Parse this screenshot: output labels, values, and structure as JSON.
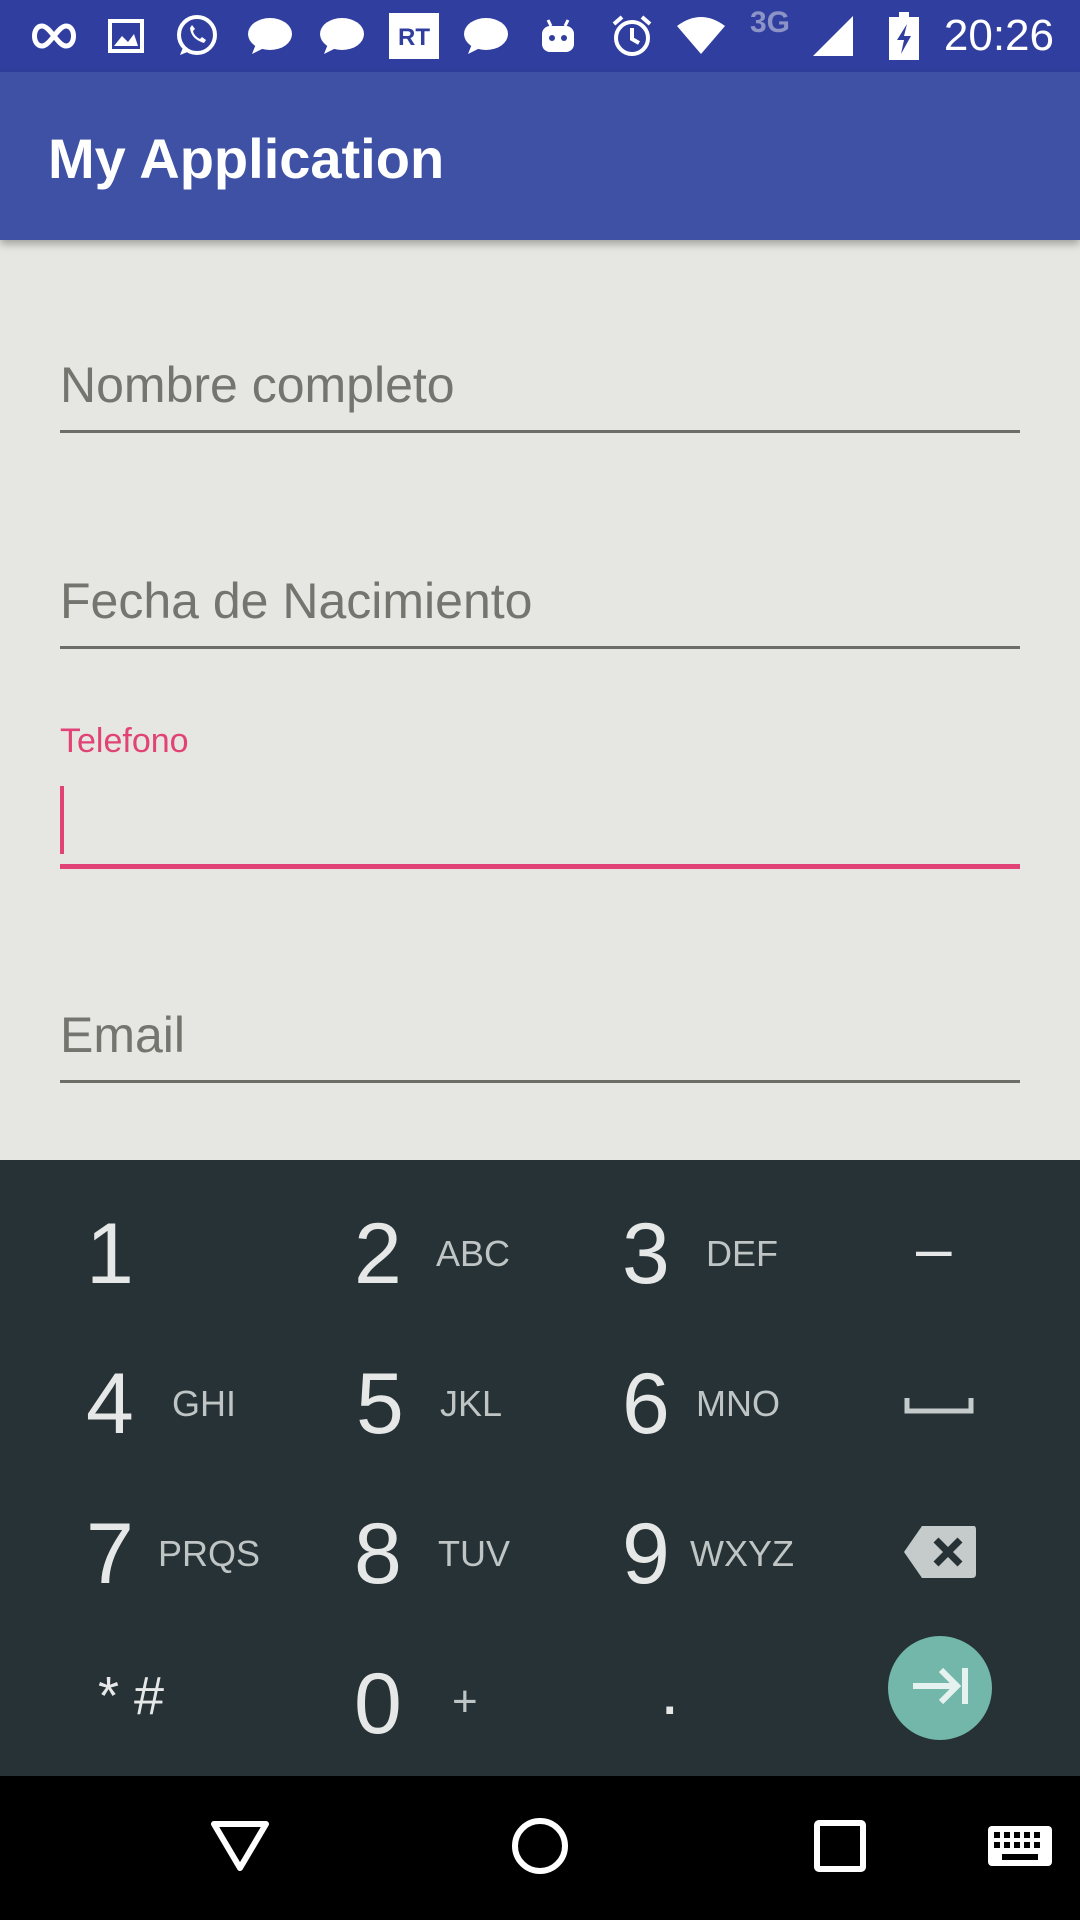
{
  "status_bar": {
    "time": "20:26",
    "network": "3G",
    "icons": [
      "infinity-icon",
      "image-icon",
      "whatsapp-icon",
      "chat-bubble-icon",
      "chat-bubble-icon",
      "rt-news-icon",
      "chat-bubble-icon",
      "android-icon",
      "alarm-icon",
      "wifi-icon",
      "signal-icon",
      "battery-charging-icon"
    ]
  },
  "app_bar": {
    "title": "My Application"
  },
  "form": {
    "nombre_placeholder": "Nombre completo",
    "fecha_placeholder": "Fecha de Nacimiento",
    "telefono_label": "Telefono",
    "telefono_value": "",
    "email_placeholder": "Email"
  },
  "keypad": {
    "keys": [
      {
        "digit": "1",
        "letters": ""
      },
      {
        "digit": "2",
        "letters": "ABC"
      },
      {
        "digit": "3",
        "letters": "DEF"
      },
      {
        "digit": "–",
        "letters": ""
      },
      {
        "digit": "4",
        "letters": "GHI"
      },
      {
        "digit": "5",
        "letters": "JKL"
      },
      {
        "digit": "6",
        "letters": "MNO"
      },
      {
        "digit": "7",
        "letters": "PRQS"
      },
      {
        "digit": "8",
        "letters": "TUV"
      },
      {
        "digit": "9",
        "letters": "WXYZ"
      },
      {
        "digit": "* #",
        "letters": ""
      },
      {
        "digit": "0",
        "letters": "+"
      },
      {
        "digit": ".",
        "letters": ""
      }
    ],
    "icons": {
      "space": "space-icon",
      "backspace": "backspace-icon",
      "next": "next-field-icon"
    },
    "accent": "#73b7aa"
  },
  "nav_bar": {
    "icons": [
      "back-icon",
      "home-icon",
      "recents-icon",
      "keyboard-icon"
    ]
  },
  "colors": {
    "primary": "#3f51a5",
    "primary_dark": "#303f9f",
    "accent": "#e24377",
    "keypad_bg": "#263235"
  }
}
